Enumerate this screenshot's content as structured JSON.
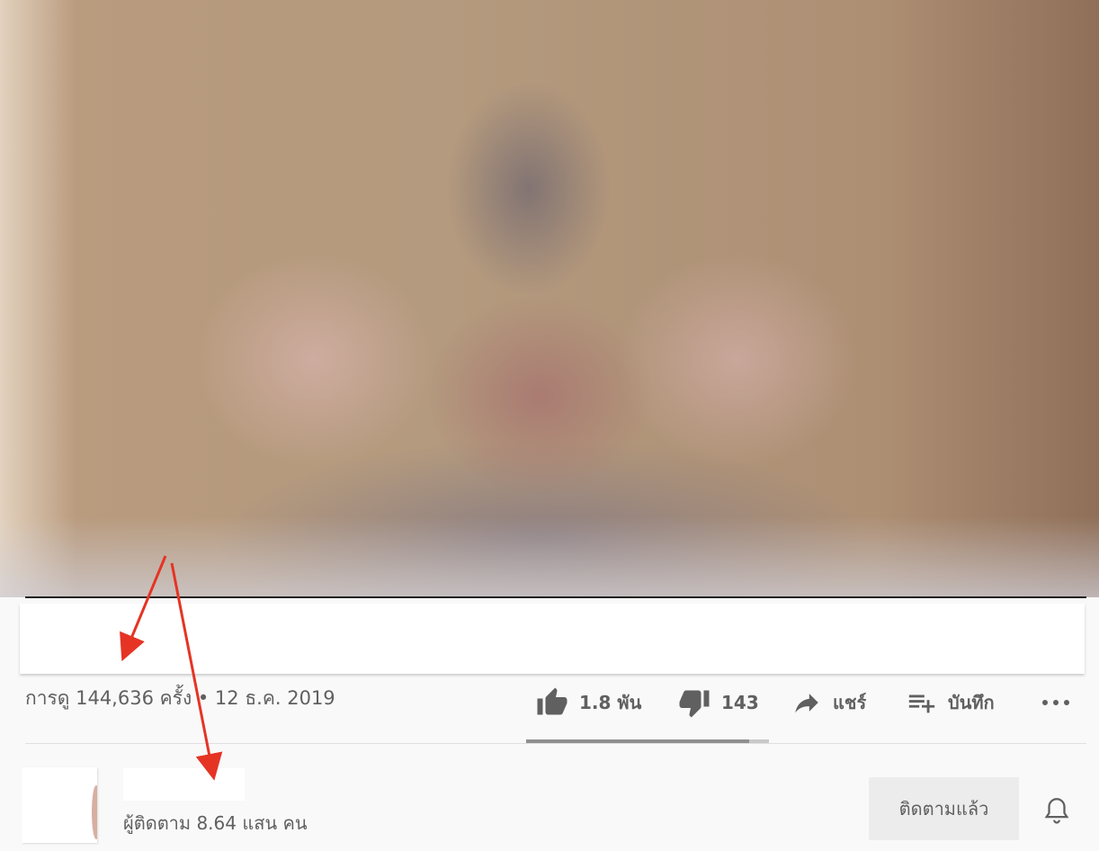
{
  "video": {
    "preview_icon": "blurred-video-frame"
  },
  "meta": {
    "views_text": "การดู 144,636 ครั้ง • 12 ธ.ค. 2019"
  },
  "actions": {
    "like": {
      "icon": "thumb-up-icon",
      "label": "1.8 พัน"
    },
    "dislike": {
      "icon": "thumb-down-icon",
      "label": "143"
    },
    "share": {
      "icon": "share-arrow-icon",
      "label": "แชร์"
    },
    "save": {
      "icon": "playlist-add-icon",
      "label": "บันทึก"
    },
    "more": {
      "icon": "more-horizontal-icon",
      "label": "•••"
    }
  },
  "sentiment": {
    "like_fraction": 0.92
  },
  "channel": {
    "subscribers_text": "ผู้ติดตาม 8.64 แสน คน",
    "subscribe_label": "ติดตามแล้ว",
    "bell_icon": "bell-icon"
  },
  "annotations": {
    "arrow_color": "#e53424"
  },
  "colors": {
    "text_secondary": "#606060",
    "button_bg": "#ececec",
    "page_bg": "#f9f9f9"
  }
}
